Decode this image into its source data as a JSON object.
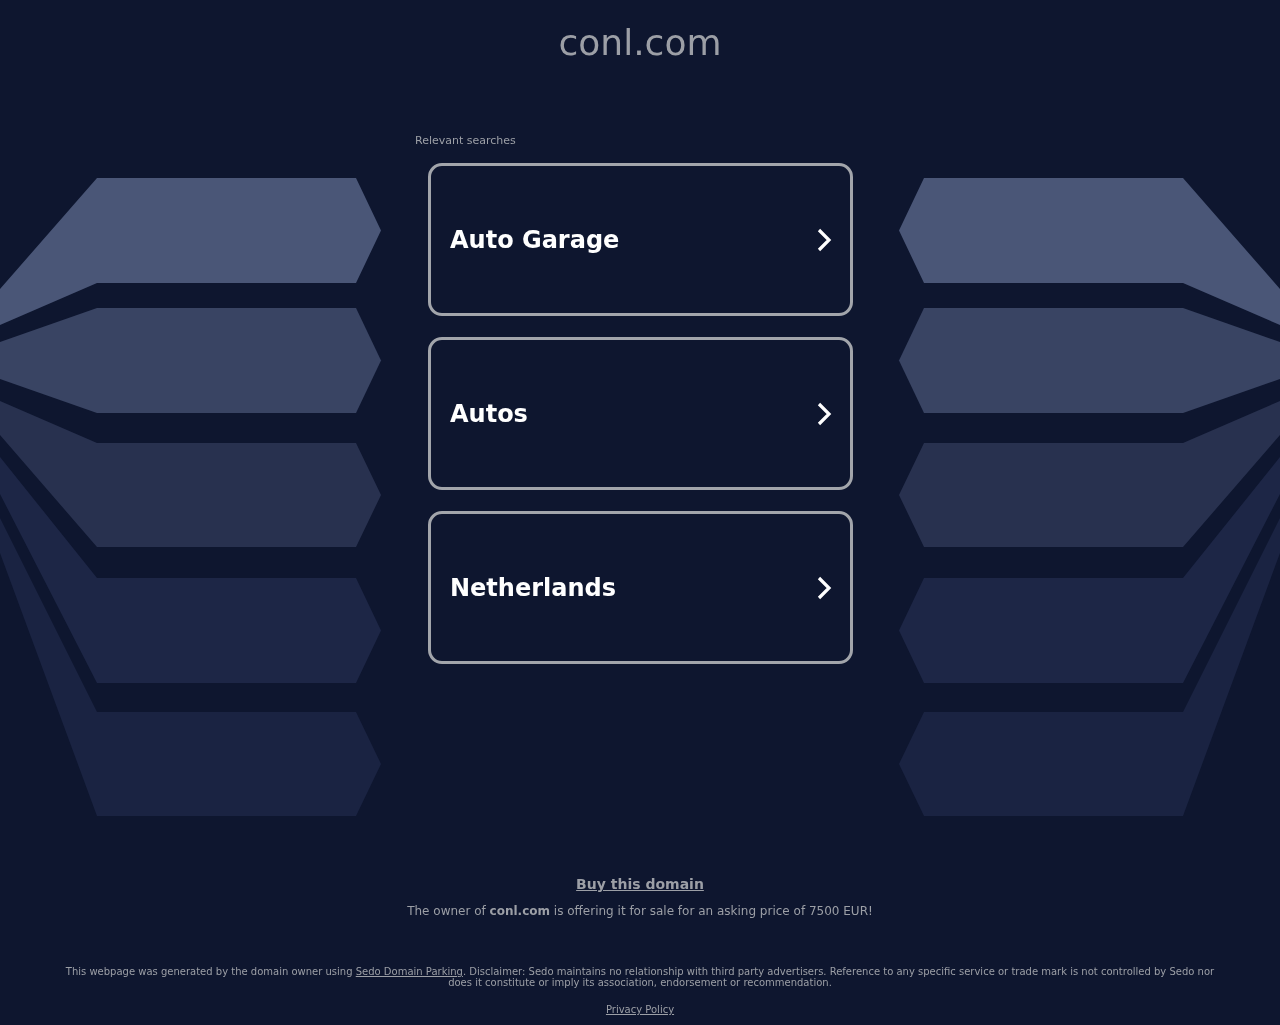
{
  "header": {
    "title": "conl.com"
  },
  "searches": {
    "heading": "Relevant searches",
    "items": [
      {
        "label": "Auto Garage"
      },
      {
        "label": "Autos"
      },
      {
        "label": "Netherlands"
      }
    ]
  },
  "sale": {
    "link": "Buy this domain",
    "text": "The owner of **conl.com** is offering it for sale for an asking price of 7500 EUR!"
  },
  "footer": {
    "disclaimer_before": "This webpage was generated by the domain owner using",
    "disclaimer_link": "Sedo Domain Parking",
    "disclaimer_after": ". Disclaimer: Sedo maintains no relationship with third party advertisers. Reference to any specific service or trade mark is not controlled by Sedo nor does it constitute or imply its association, endorsement or recommendation.",
    "privacy_link": "Privacy Policy"
  }
}
